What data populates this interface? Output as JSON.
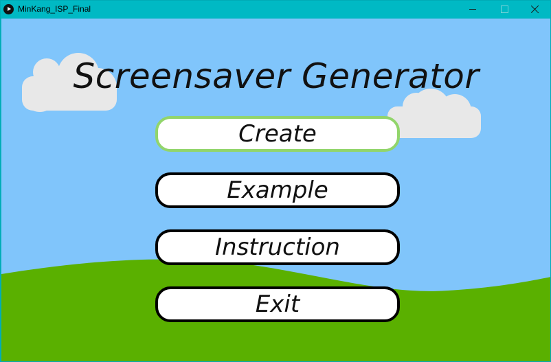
{
  "window": {
    "title": "MinKang_ISP_Final",
    "app_icon": "play-icon",
    "controls": {
      "minimize_icon": "minimize-icon",
      "maximize_icon": "maximize-icon",
      "close_icon": "close-icon"
    }
  },
  "scene": {
    "sky_color": "#80c5fb",
    "grass_color": "#5ab000",
    "cloud_color": "#e8e8e8"
  },
  "main": {
    "title": "Screensaver Generator",
    "buttons": [
      {
        "label": "Create",
        "state": "hovered",
        "border_color": "#92d56b"
      },
      {
        "label": "Example",
        "state": "normal",
        "border_color": "#000000"
      },
      {
        "label": "Instruction",
        "state": "normal",
        "border_color": "#000000"
      },
      {
        "label": "Exit",
        "state": "normal",
        "border_color": "#000000"
      }
    ]
  }
}
